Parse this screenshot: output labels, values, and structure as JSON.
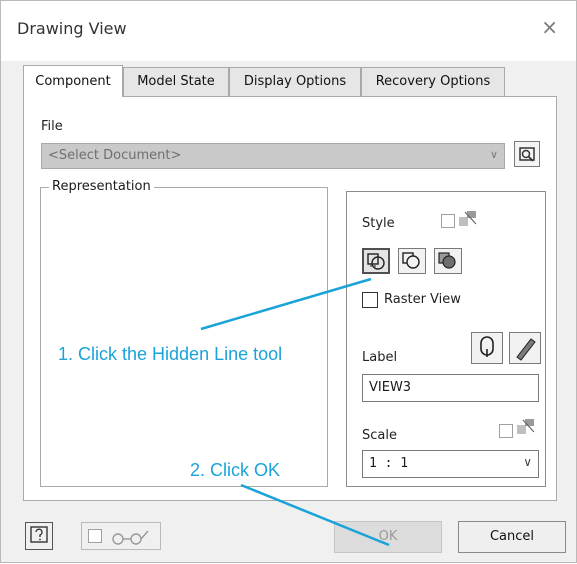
{
  "window": {
    "title": "Drawing View",
    "close_glyph": "×"
  },
  "tabs": [
    {
      "label": "Component",
      "active": true
    },
    {
      "label": "Model State",
      "active": false
    },
    {
      "label": "Display Options",
      "active": false
    },
    {
      "label": "Recovery Options",
      "active": false
    }
  ],
  "file": {
    "label": "File",
    "placeholder": "<Select Document>"
  },
  "representation": {
    "title": "Representation"
  },
  "style": {
    "label": "Style",
    "buttons": [
      {
        "name": "hidden-line",
        "icon": "hidden-line-icon",
        "selected": true
      },
      {
        "name": "hidden-line-removed",
        "icon": "hidden-line-removed-icon",
        "selected": false
      },
      {
        "name": "shaded",
        "icon": "shaded-icon",
        "selected": false
      }
    ],
    "raster_label": "Raster View"
  },
  "label_section": {
    "label": "Label",
    "value": "VIEW3"
  },
  "scale": {
    "label": "Scale",
    "value": "1 : 1"
  },
  "annotations": {
    "step1": "1. Click the Hidden Line tool",
    "step2": "2. Click OK",
    "color": "#1aa3d9"
  },
  "footer": {
    "ok_label": "OK",
    "cancel_label": "Cancel"
  }
}
